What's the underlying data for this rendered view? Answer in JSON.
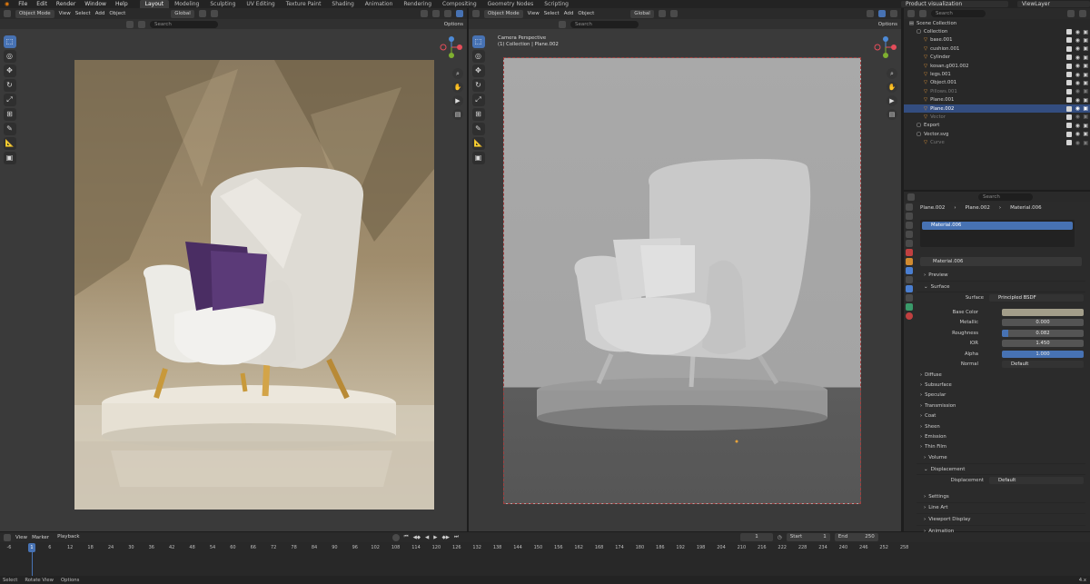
{
  "topbar": {
    "menus": [
      "File",
      "Edit",
      "Render",
      "Window",
      "Help"
    ],
    "workspaces": [
      "Layout",
      "Modeling",
      "Sculpting",
      "UV Editing",
      "Texture Paint",
      "Shading",
      "Animation",
      "Rendering",
      "Compositing",
      "Geometry Nodes",
      "Scripting"
    ],
    "active_workspace": "Layout",
    "scene": "Product visualization",
    "view_layer": "ViewLayer"
  },
  "left_viewport": {
    "mode": "Object Mode",
    "menus": [
      "View",
      "Select",
      "Add",
      "Object"
    ],
    "orientation": "Global",
    "search_placeholder": "Search",
    "options": "Options"
  },
  "right_viewport": {
    "mode": "Object Mode",
    "menus": [
      "View",
      "Select",
      "Add",
      "Object"
    ],
    "orientation": "Global",
    "search_placeholder": "Search",
    "options": "Options",
    "camera_label": "Camera Perspective",
    "collection_label": "(1) Collection | Plane.002"
  },
  "outliner": {
    "search_placeholder": "Search",
    "root": "Scene Collection",
    "items": [
      {
        "label": "Collection",
        "indent": 0,
        "kind": "collection"
      },
      {
        "label": "base.001",
        "indent": 1,
        "kind": "mesh"
      },
      {
        "label": "cushion.001",
        "indent": 1,
        "kind": "mesh"
      },
      {
        "label": "Cylinder",
        "indent": 1,
        "kind": "mesh"
      },
      {
        "label": "kosan.g001.002",
        "indent": 1,
        "kind": "mesh"
      },
      {
        "label": "legs.001",
        "indent": 1,
        "kind": "mesh"
      },
      {
        "label": "Object.001",
        "indent": 1,
        "kind": "mesh"
      },
      {
        "label": "Pillows.001",
        "indent": 1,
        "kind": "mesh",
        "dim": true
      },
      {
        "label": "Plane.001",
        "indent": 1,
        "kind": "mesh"
      },
      {
        "label": "Plane.002",
        "indent": 1,
        "kind": "mesh",
        "selected": true
      },
      {
        "label": "Vector",
        "indent": 1,
        "kind": "curve",
        "dim": true
      },
      {
        "label": "Export",
        "indent": 0,
        "kind": "collection"
      },
      {
        "label": "Vector.svg",
        "indent": 0,
        "kind": "collection"
      },
      {
        "label": "Curve",
        "indent": 1,
        "kind": "curve",
        "dim": true
      }
    ]
  },
  "properties": {
    "search_placeholder": "Search",
    "breadcrumb": [
      "Plane.002",
      "Plane.002",
      "Material.006"
    ],
    "slot": "Material.006",
    "material_name": "Material.006",
    "sections_top": [
      "Preview",
      "Surface"
    ],
    "surface_label": "Surface",
    "surface_value": "Principled BSDF",
    "rows": [
      {
        "label": "Base Color",
        "value": "",
        "kind": "color"
      },
      {
        "label": "Metallic",
        "value": "0.000",
        "kind": "num"
      },
      {
        "label": "Roughness",
        "value": "0.082",
        "kind": "slider"
      },
      {
        "label": "IOR",
        "value": "1.450",
        "kind": "num"
      },
      {
        "label": "Alpha",
        "value": "1.000",
        "kind": "full"
      },
      {
        "label": "Normal",
        "value": "Default",
        "kind": "socket"
      }
    ],
    "subsections": [
      "Diffuse",
      "Subsurface",
      "Specular",
      "Transmission",
      "Coat",
      "Sheen",
      "Emission",
      "Thin Film"
    ],
    "volume": "Volume",
    "displacement": "Displacement",
    "displacement_label": "Displacement",
    "displacement_value": "Default",
    "bottom_sections": [
      "Settings",
      "Line Art",
      "Viewport Display",
      "Animation",
      "Custom Properties"
    ]
  },
  "timeline": {
    "menus": [
      "View",
      "Marker",
      "Playback"
    ],
    "current_frame": "1",
    "start_label": "Start",
    "start": "1",
    "end_label": "End",
    "end": "250",
    "ticks": [
      "-6",
      "0",
      "6",
      "12",
      "18",
      "24",
      "30",
      "36",
      "42",
      "48",
      "54",
      "60",
      "66",
      "72",
      "78",
      "84",
      "90",
      "96",
      "102",
      "108",
      "114",
      "120",
      "126",
      "132",
      "138",
      "144",
      "150",
      "156",
      "162",
      "168",
      "174",
      "180",
      "186",
      "192",
      "198",
      "204",
      "210",
      "216",
      "222",
      "228",
      "234",
      "240",
      "246",
      "252",
      "258"
    ]
  },
  "statusbar": {
    "items": [
      "Select",
      "Rotate View",
      "Options"
    ],
    "version": "4.x"
  },
  "colors": {
    "accent": "#4772b3",
    "selection": "#334d80",
    "base_color_swatch": "#a39e8a",
    "playhead": "#4772b3"
  }
}
